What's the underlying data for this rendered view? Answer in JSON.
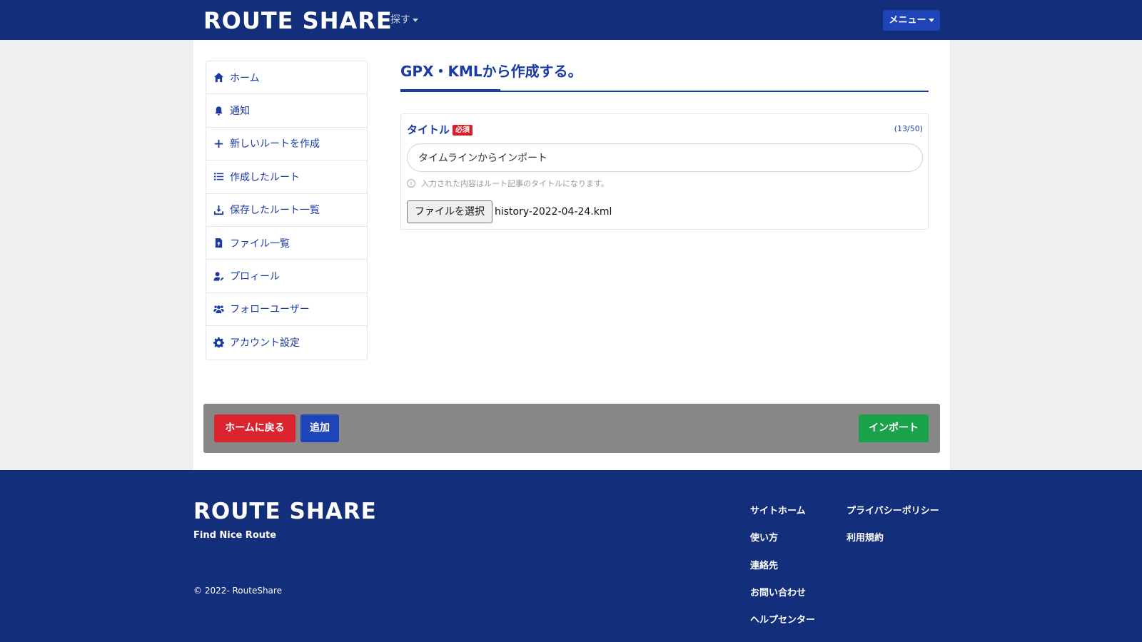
{
  "navbar": {
    "logo": "ROUTE SHARE",
    "explore_label": "探す",
    "menu_label": "メニュー"
  },
  "sidebar": {
    "items": [
      {
        "label": "ホーム",
        "icon": "home-icon"
      },
      {
        "label": "通知",
        "icon": "bell-icon"
      },
      {
        "label": "新しいルートを作成",
        "icon": "plus-icon"
      },
      {
        "label": "作成したルート",
        "icon": "list-icon"
      },
      {
        "label": "保存したルート一覧",
        "icon": "download-icon"
      },
      {
        "label": "ファイル一覧",
        "icon": "file-upload-icon"
      },
      {
        "label": "プロィール",
        "icon": "user-edit-icon"
      },
      {
        "label": "フォローユーザー",
        "icon": "users-icon"
      },
      {
        "label": "アカウント設定",
        "icon": "gear-icon"
      }
    ]
  },
  "content": {
    "page_title": "GPX・KMLから作成する。",
    "form": {
      "title_label": "タイトル",
      "required_badge": "必須",
      "counter": "(13/50)",
      "title_value": "タイムラインからインポート",
      "help_text": "入力された内容はルート記事のタイトルになります。",
      "file_button": "ファイルを選択",
      "file_name": "history-2022-04-24.kml"
    }
  },
  "actions": {
    "home_label": "ホームに戻る",
    "add_label": "追加",
    "import_label": "インポート"
  },
  "footer": {
    "logo": "ROUTE SHARE",
    "tagline": "Find Nice Route",
    "copyright": "© 2022- RouteShare",
    "col1": [
      "サイトホーム",
      "使い方",
      "連絡先",
      "お問い合わせ",
      "ヘルプセンター"
    ],
    "col2": [
      "プライバシーポリシー",
      "利用規約"
    ]
  },
  "colors": {
    "navy": "#132e7a",
    "accent_blue": "#1a3aa6",
    "danger": "#dc2430",
    "success": "#1aa34a",
    "action_bar": "#878787"
  }
}
